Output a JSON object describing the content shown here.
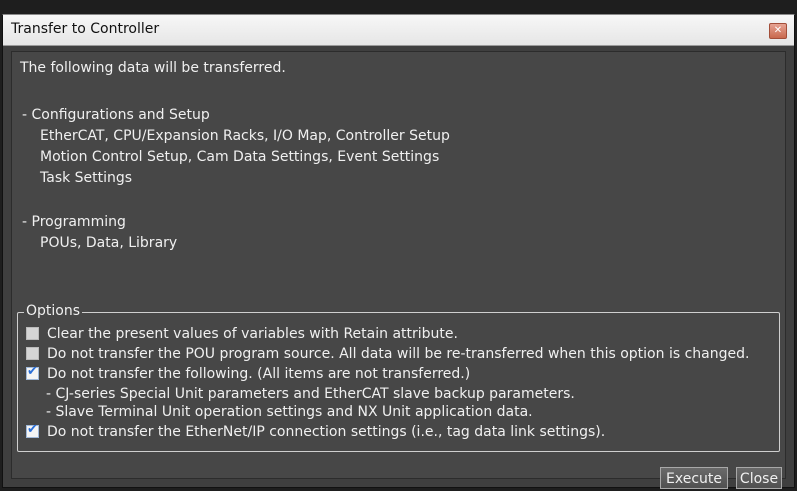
{
  "window": {
    "title": "Transfer to Controller",
    "close_glyph": "✕"
  },
  "intro": "The following data will be transferred.",
  "sections": {
    "config_heading": "- Configurations and Setup",
    "config_items": [
      "EtherCAT, CPU/Expansion Racks, I/O Map, Controller Setup",
      "Motion Control Setup, Cam Data Settings, Event Settings",
      "Task Settings"
    ],
    "programming_heading": "- Programming",
    "programming_items": [
      "POUs, Data, Library"
    ]
  },
  "options": {
    "legend": "Options",
    "items": [
      {
        "label": "Clear the present values of variables with Retain attribute.",
        "checked": false
      },
      {
        "label": "Do not transfer the POU program source. All data will be re-transferred when this option is changed.",
        "checked": false
      },
      {
        "label": "Do not transfer the following. (All items are not transferred.)",
        "checked": true
      },
      {
        "label": "Do not transfer the EtherNet/IP connection settings (i.e., tag data link settings).",
        "checked": true
      }
    ],
    "sub_items": [
      "- CJ-series Special Unit parameters and EtherCAT slave backup parameters.",
      "- Slave Terminal Unit operation settings and NX Unit application data."
    ],
    "check_glyph": "✔"
  },
  "buttons": {
    "execute": "Execute",
    "close": "Close"
  },
  "colors": {
    "panel": "#474747",
    "check_accent": "#2a6fd8"
  }
}
